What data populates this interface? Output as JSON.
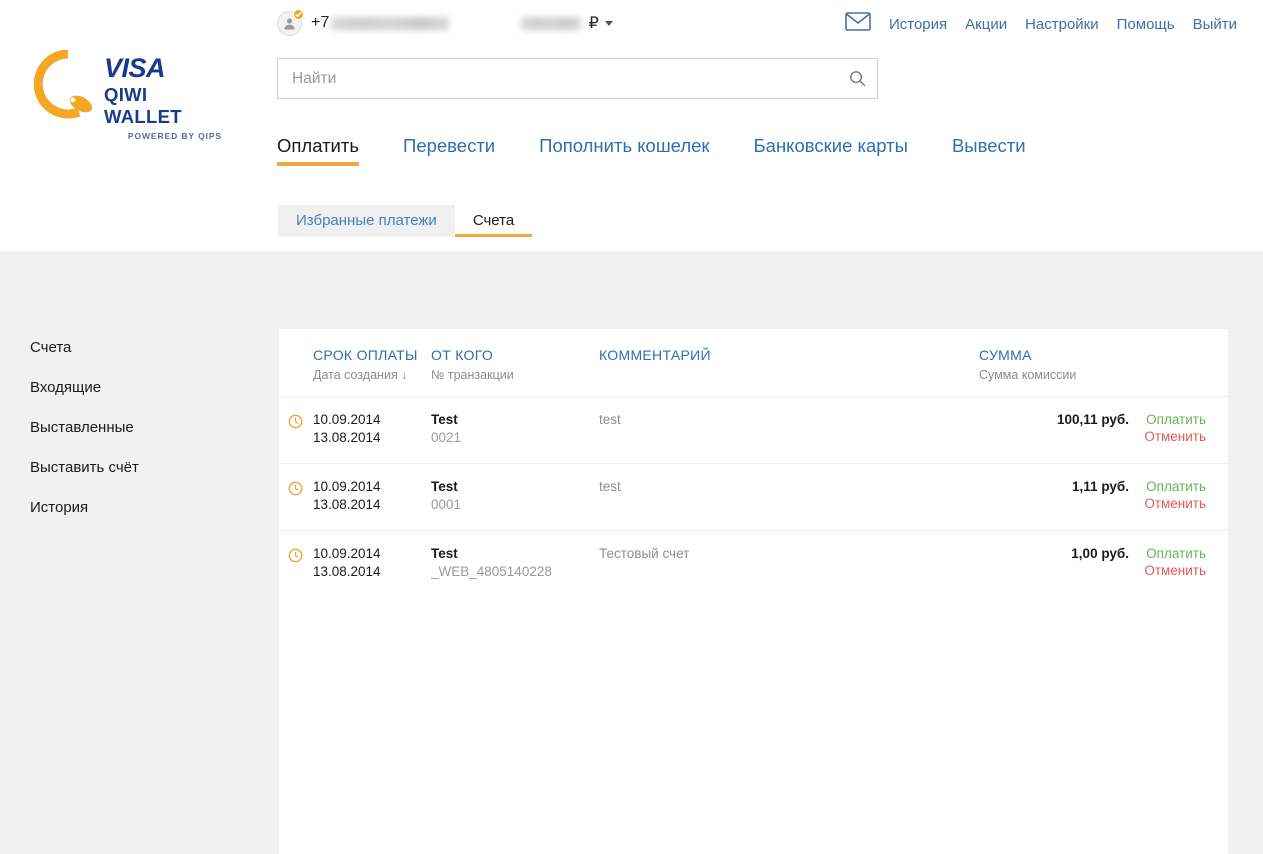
{
  "colors": {
    "brand_orange": "#f0a73c",
    "brand_blue": "#1a3a8f",
    "link_blue": "#2f6fad",
    "pay_green": "#63b652",
    "cancel_red": "#e05a4e",
    "page_bg": "#f1f1f1"
  },
  "logo": {
    "visa": "VISA",
    "wallet": "QIWI WALLET",
    "powered": "POWERED BY QIPS",
    "mark_icon": "qiwi-q-logo-icon"
  },
  "account": {
    "avatar_icon": "user-avatar-icon",
    "verified_badge_icon": "verified-check-icon",
    "phone_prefix": "+7",
    "phone_redacted": "",
    "balance_redacted": "",
    "currency": "₽",
    "dropdown_icon": "chevron-down-icon"
  },
  "topnav": {
    "mail_icon": "envelope-icon",
    "links": [
      {
        "label": "История",
        "name": "history"
      },
      {
        "label": "Акции",
        "name": "promotions"
      },
      {
        "label": "Настройки",
        "name": "settings"
      },
      {
        "label": "Помощь",
        "name": "help"
      },
      {
        "label": "Выйти",
        "name": "logout"
      }
    ]
  },
  "search": {
    "placeholder": "Найти",
    "value": "",
    "icon": "search-icon"
  },
  "main_tabs": [
    {
      "label": "Оплатить",
      "name": "pay",
      "active": true
    },
    {
      "label": "Перевести",
      "name": "transfer",
      "active": false
    },
    {
      "label": "Пополнить кошелек",
      "name": "topup",
      "active": false
    },
    {
      "label": "Банковские карты",
      "name": "bank-cards",
      "active": false
    },
    {
      "label": "Вывести",
      "name": "withdraw",
      "active": false
    }
  ],
  "sub_tabs": [
    {
      "label": "Избранные платежи",
      "name": "favorite-payments",
      "active": false
    },
    {
      "label": "Счета",
      "name": "invoices",
      "active": true
    }
  ],
  "sidebar": {
    "items": [
      {
        "label": "Счета",
        "name": "invoices"
      },
      {
        "label": "Входящие",
        "name": "incoming"
      },
      {
        "label": "Выставленные",
        "name": "issued"
      },
      {
        "label": "Выставить счёт",
        "name": "create-invoice"
      },
      {
        "label": "История",
        "name": "history"
      }
    ]
  },
  "table": {
    "headers": {
      "due_date": "СРОК ОПЛАТЫ",
      "due_date_sub": "Дата создания ↓",
      "from": "ОТ КОГО",
      "from_sub": "№ транзакции",
      "comment": "КОММЕНТАРИЙ",
      "sum": "СУММА",
      "sum_sub": "Сумма комиссии"
    },
    "actions": {
      "pay": "Оплатить",
      "cancel": "Отменить"
    },
    "status_icon": "pending-clock-icon",
    "rows": [
      {
        "due_date": "10.09.2014",
        "created_date": "13.08.2014",
        "from": "Test",
        "txn": "0021",
        "comment": "test",
        "sum": "100,11 руб."
      },
      {
        "due_date": "10.09.2014",
        "created_date": "13.08.2014",
        "from": "Test",
        "txn": "0001",
        "comment": "test",
        "sum": "1,11 руб."
      },
      {
        "due_date": "10.09.2014",
        "created_date": "13.08.2014",
        "from": "Test",
        "txn": "_WEB_4805140228",
        "comment": "Тестовый счет",
        "sum": "1,00 руб."
      }
    ]
  }
}
